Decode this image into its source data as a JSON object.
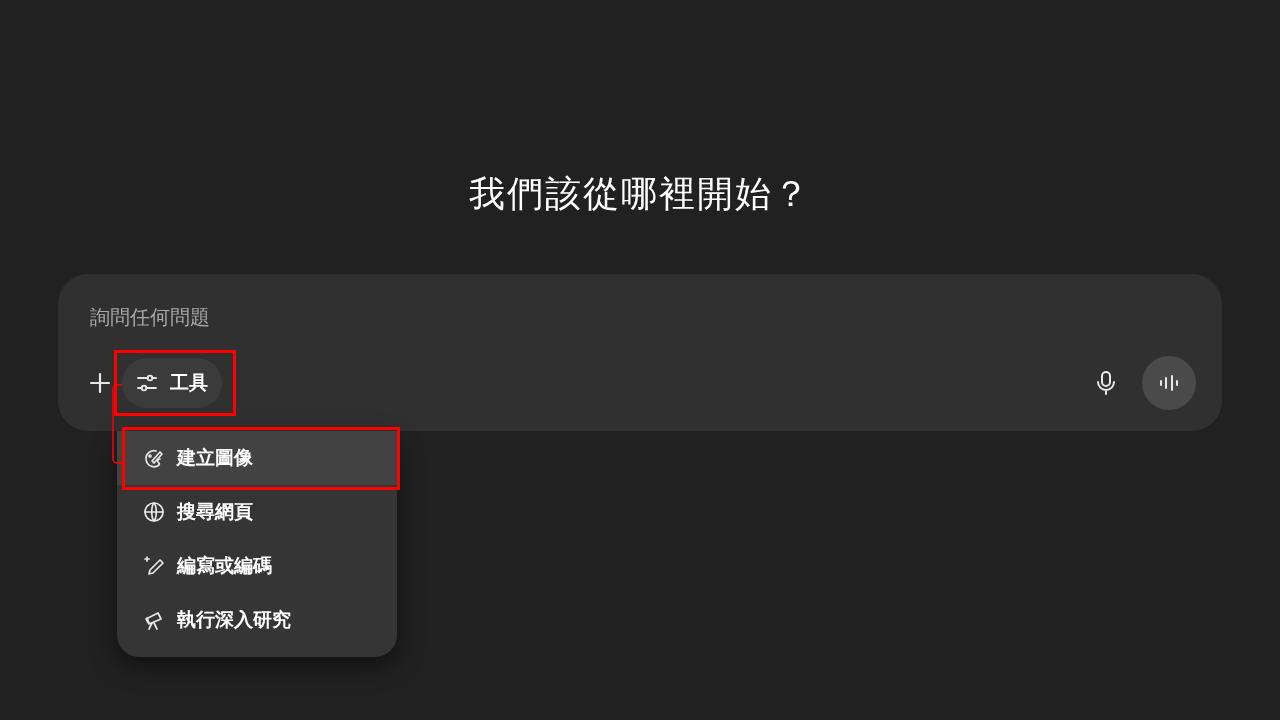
{
  "heading": "我們該從哪裡開始？",
  "composer": {
    "placeholder": "詢問任何問題",
    "tools_button": {
      "label": "工具",
      "highlighted": true
    }
  },
  "tools_menu": {
    "items": [
      {
        "label": "建立圖像",
        "selected": true,
        "highlighted": true
      },
      {
        "label": "搜尋網頁",
        "selected": false,
        "highlighted": false
      },
      {
        "label": "編寫或編碼",
        "selected": false,
        "highlighted": false
      },
      {
        "label": "執行深入研究",
        "selected": false,
        "highlighted": false
      }
    ]
  }
}
